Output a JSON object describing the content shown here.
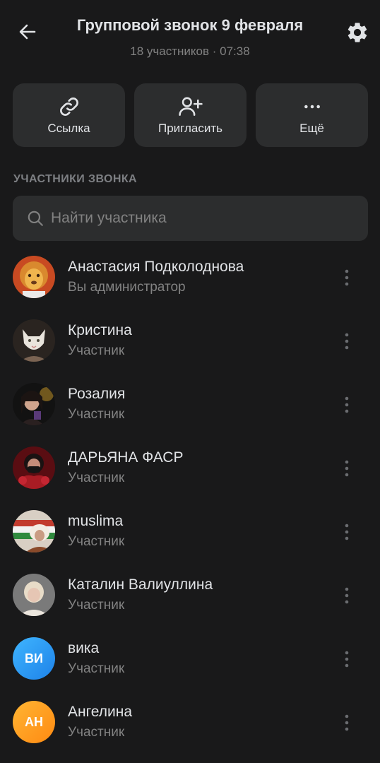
{
  "header": {
    "title": "Групповой звонок 9 февраля",
    "subtitle": "18 участников · 07:38",
    "back_icon": "arrow-left-icon",
    "settings_icon": "gear-icon"
  },
  "actions": [
    {
      "label": "Ссылка",
      "icon": "link-icon"
    },
    {
      "label": "Пригласить",
      "icon": "add-user-icon"
    },
    {
      "label": "Ещё",
      "icon": "more-horizontal-icon"
    }
  ],
  "section_title": "УЧАСТНИКИ ЗВОНКА",
  "search": {
    "placeholder": "Найти участника",
    "value": ""
  },
  "participants": [
    {
      "name": "Анастасия Подколоднова",
      "role": "Вы администратор",
      "avatar": "photo"
    },
    {
      "name": "Кристина",
      "role": "Участник",
      "avatar": "photo"
    },
    {
      "name": "Розалия",
      "role": "Участник",
      "avatar": "photo"
    },
    {
      "name": "ДАРЬЯНА ФАСР",
      "role": "Участник",
      "avatar": "photo"
    },
    {
      "name": "muslima",
      "role": "Участник",
      "avatar": "photo"
    },
    {
      "name": "Каталин Валиуллина",
      "role": "Участник",
      "avatar": "photo"
    },
    {
      "name": "вика",
      "role": "Участник",
      "avatar": "initials",
      "initials": "ВИ"
    },
    {
      "name": "Ангелина",
      "role": "Участник",
      "avatar": "initials",
      "initials": "АН"
    }
  ],
  "colors": {
    "background": "#19191a",
    "surface": "#2c2d2e",
    "text_primary": "#e1e3e6",
    "text_secondary": "#828282",
    "avatar_vi": "#2e9df5",
    "avatar_an": "#ff9f1a"
  }
}
